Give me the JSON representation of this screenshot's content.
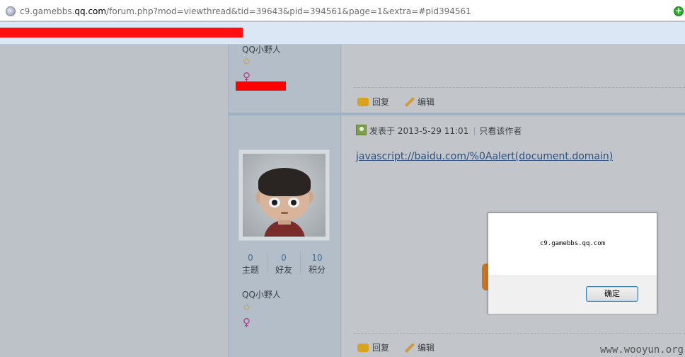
{
  "browser": {
    "url_prefix": "c9.gamebbs.",
    "url_domain": "qq.com",
    "url_rest": "/forum.php?mod=viewthread&tid=39643&pid=394561&page=1&extra=#pid394561",
    "go_icon": "+"
  },
  "forum": {
    "prev_post": {
      "username": "QQ小野人",
      "actions": {
        "reply": "回复",
        "edit": "编辑"
      }
    },
    "post": {
      "stats": [
        {
          "value": "0",
          "label": "主题"
        },
        {
          "value": "0",
          "label": "好友"
        },
        {
          "value": "10",
          "label": "积分"
        }
      ],
      "username": "QQ小野人",
      "meta": {
        "posted": "发表于 2013-5-29 11:01",
        "only_author": "只看该作者"
      },
      "content_link": "javascript://baidu.com/%0Aalert(document.domain)",
      "actions": {
        "reply": "回复",
        "edit": "编辑"
      }
    }
  },
  "dialog": {
    "message": "c9.gamebbs.qq.com",
    "ok_label": "确定"
  },
  "watermark": "www.wooyun.org"
}
